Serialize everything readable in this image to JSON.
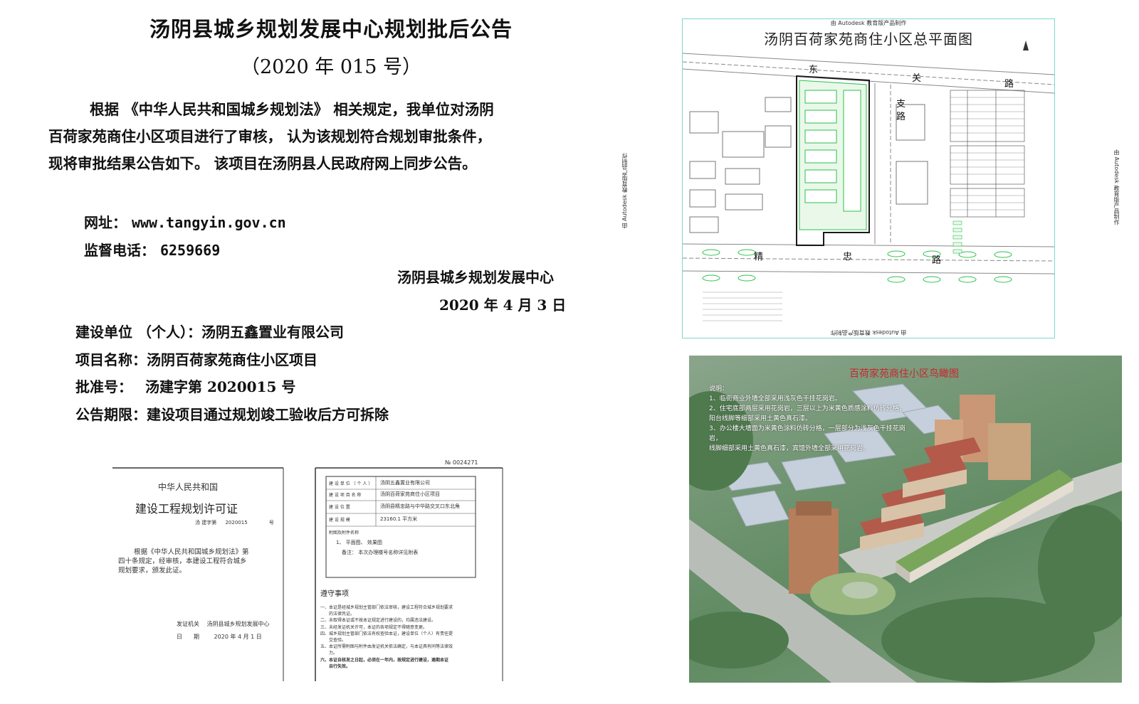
{
  "notice": {
    "title": "汤阴县城乡规划发展中心规划批后公告",
    "number": "（2020 年 015 号）",
    "para_lines": [
      "根据 《中华人民共和国城乡规划法》 相关规定，我单位对汤阴",
      "百荷家苑商住小区项目进行了审核， 认为该规划符合规划审批条件，",
      "现将审批结果公告如下。 该项目在汤阴县人民政府网上同步公告。"
    ],
    "website_label": "网址：",
    "website": "www.tangyin.gov.cn",
    "phone_label": "监督电话：",
    "phone": "6259669",
    "issuer": "汤阴县城乡规划发展中心",
    "date": "2020 年 4 月 3 日",
    "details": [
      {
        "label": "建设单位 （个人）：",
        "value": "汤阴五鑫置业有限公司"
      },
      {
        "label": "项目名称：",
        "value": "汤阴百荷家苑商住小区项目"
      },
      {
        "label": "批准号：",
        "value": "汤建字第 2020015 号"
      },
      {
        "label": "公告期限：",
        "value": "建设项目通过规划竣工验收后方可拆除"
      }
    ]
  },
  "plan": {
    "header": "由 Autodesk 教育版产品制作",
    "title": "汤阴百荷家苑商住小区总平面图",
    "road_dong": "东",
    "road_guan": "关",
    "road_lu": "路",
    "road_zhi": "支",
    "road_zhi_lu": "路",
    "road_jing": "精",
    "road_zhong": "忠",
    "road_jing_lu": "路",
    "side_left": "由 Autodesk 教育版产品制作",
    "side_right": "由 Autodesk 教育版产品制作"
  },
  "aerial": {
    "title": "百荷家苑商住小区鸟瞰图",
    "notes": [
      "说明：",
      "1、临街商业外墙全部采用浅灰色干挂花岗岩。",
      "2、住宅底部两层采用花岗岩，三层以上为米黄色质感涂料仿砖分格，",
      "阳台线脚等细部采用土黄色真石漆。",
      "3、办公楼大墙面为米黄色涂料仿砖分格，一层部分为浅灰色干挂花岗岩，",
      "线脚细部采用土黄色真石漆，宾馆外墙全部采用花岗岩。"
    ]
  },
  "permit": {
    "serial": "№ 0024271",
    "country": "中华人民共和国",
    "doc_title": "建设工程规划许可证",
    "ref_prefix": "汤",
    "ref_mid": "建字第",
    "ref_no": "2020015",
    "ref_suffix": "号",
    "body": [
      "根据《中华人民共和国城乡规划法》第",
      "四十条规定，经审核，本建设工程符合城乡",
      "规划要求，颁发此证。"
    ],
    "issuer_label": "发证机关",
    "issuer": "汤阴县城乡规划发展中心",
    "date_label": "日　　期",
    "date": "2020 年 4 月 1 日",
    "rows": [
      {
        "label": "建 设 单 位 （ 个 人 ）",
        "value": "汤阴五鑫置业有限公司"
      },
      {
        "label": "建 设 项 目 名 称",
        "value": "汤阴百荷家苑商住小区项目"
      },
      {
        "label": "建 设 位 置",
        "value": "汤阴县精忠路与中华路交叉口东北角"
      },
      {
        "label": "建 设 规 模",
        "value": "23160.1 平方米"
      }
    ],
    "attach_label": "附图及附件名称",
    "attach_item": "1、 平面图、 效果图",
    "remark": "备注： 本次办理楼号名称详见附表",
    "rules_title": "遵守事项",
    "rules": [
      "一、本证是经城乡规划主管部门依法审核，建设工程符合城乡规划要求",
      "的法律凭证。",
      "二、未取得本证或不按本证规定进行建设的，均属违法建设。",
      "三、未经发证机关许可，本证的各项规定不得随意变更。",
      "四、城乡规划主管部门依法有权查验本证，建设单位（个人）有责任提",
      "交查验。",
      "五、本证所需附图与附件由发证机关依法确定，与本证具有同等法律效",
      "力。",
      "六、本证自核发之日起，必须在一年内，按规定进行建设，逾期本证",
      "自行失效。"
    ]
  }
}
